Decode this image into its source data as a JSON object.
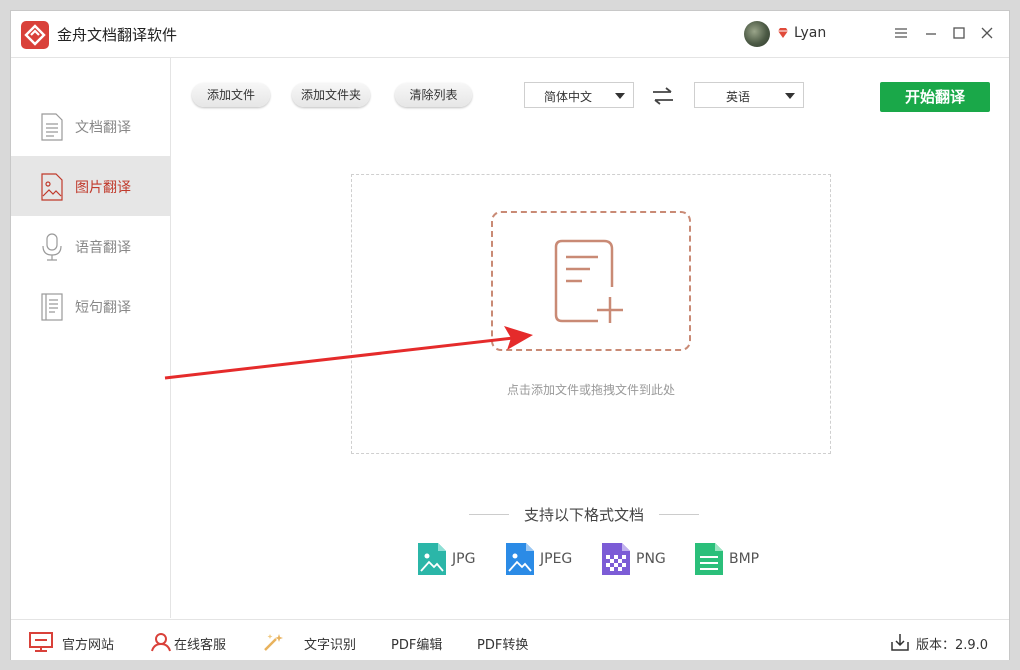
{
  "app": {
    "title": "金舟文档翻译软件",
    "username": "Lyan"
  },
  "sidebar": {
    "items": [
      {
        "label": "文档翻译",
        "icon": "document-icon",
        "active": false
      },
      {
        "label": "图片翻译",
        "icon": "image-icon",
        "active": true
      },
      {
        "label": "语音翻译",
        "icon": "microphone-icon",
        "active": false
      },
      {
        "label": "短句翻译",
        "icon": "sentence-icon",
        "active": false
      }
    ]
  },
  "toolbar": {
    "add_file": "添加文件",
    "add_folder": "添加文件夹",
    "clear_list": "清除列表",
    "source_lang": "简体中文",
    "target_lang": "英语",
    "start": "开始翻译"
  },
  "dropzone": {
    "hint": "点击添加文件或拖拽文件到此处"
  },
  "formats": {
    "title": "支持以下格式文档",
    "items": [
      {
        "label": "JPG",
        "color": "#2bb6a8"
      },
      {
        "label": "JPEG",
        "color": "#2b8be6"
      },
      {
        "label": "PNG",
        "color": "#7c5cd6"
      },
      {
        "label": "BMP",
        "color": "#2bbf7a"
      }
    ]
  },
  "footer": {
    "website": "官方网站",
    "support": "在线客服",
    "ocr": "文字识别",
    "pdf_edit": "PDF编辑",
    "pdf_convert": "PDF转换",
    "version": "版本：2.9.0"
  },
  "colors": {
    "brand": "#d9413a",
    "start_button": "#1aa849",
    "active_text": "#c0392b",
    "arrow": "#e52b2b"
  }
}
